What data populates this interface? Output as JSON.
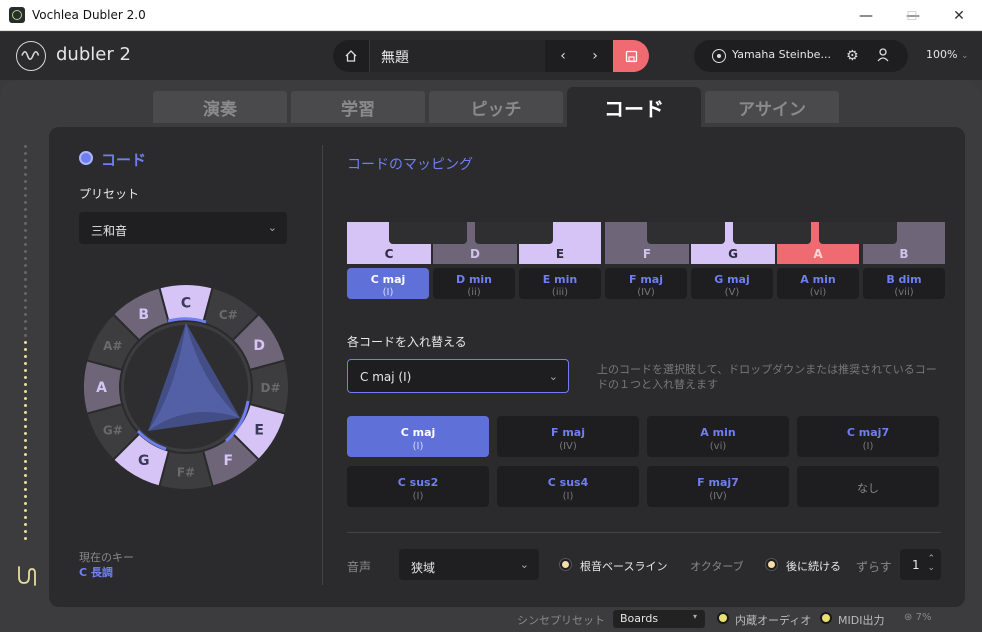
{
  "window": {
    "title": "Vochlea Dubler 2.0",
    "minimize": "—",
    "maximize": "☐",
    "close": "✕"
  },
  "appbar": {
    "logo_text": "dubler 2",
    "project_name": "無題",
    "device_name": "Yamaha Steinbe...",
    "zoom": "100%"
  },
  "tabs": [
    {
      "label": "演奏"
    },
    {
      "label": "学習"
    },
    {
      "label": "ピッチ"
    },
    {
      "label": "コード"
    },
    {
      "label": "アサイン"
    }
  ],
  "left": {
    "toggle_label": "コード",
    "preset_label": "プリセット",
    "preset_value": "三和音",
    "wheel_notes": [
      "C",
      "C#",
      "D",
      "D#",
      "E",
      "F",
      "F#",
      "G",
      "G#",
      "A",
      "A#",
      "B"
    ],
    "current_key_label": "現在のキー",
    "current_key_value": "C 長調"
  },
  "right": {
    "title": "コードのマッピング",
    "white_keys": [
      "C",
      "D",
      "E",
      "F",
      "G",
      "A",
      "B"
    ],
    "chords": [
      {
        "name": "C maj",
        "num": "(I)"
      },
      {
        "name": "D min",
        "num": "(ii)"
      },
      {
        "name": "E min",
        "num": "(iii)"
      },
      {
        "name": "F maj",
        "num": "(IV)"
      },
      {
        "name": "G maj",
        "num": "(V)"
      },
      {
        "name": "A min",
        "num": "(vi)"
      },
      {
        "name": "B dim",
        "num": "(vii)"
      }
    ],
    "replace_label": "各コードを入れ替える",
    "replace_value": "C maj (I)",
    "replace_hint": "上のコードを選択肢して、ドロップダウンまたは推奨されているコードの１つと入れ替えます",
    "alternatives": [
      {
        "name": "C maj",
        "num": "(I)"
      },
      {
        "name": "F maj",
        "num": "(IV)"
      },
      {
        "name": "A min",
        "num": "(vi)"
      },
      {
        "name": "C maj7",
        "num": "(I)"
      },
      {
        "name": "C sus2",
        "num": "(I)"
      },
      {
        "name": "C sus4",
        "num": "(I)"
      },
      {
        "name": "F maj7",
        "num": "(IV)"
      },
      {
        "name": "なし",
        "num": ""
      }
    ],
    "voice_label": "音声",
    "voice_value": "狭域",
    "root_bass_label": "根音ベースライン",
    "octave_label": "オクターブ",
    "follow_label": "後に続ける",
    "shift_label": "ずらす",
    "shift_value": "1"
  },
  "statusbar": {
    "synth_preset_label": "シンセプリセット",
    "synth_preset_value": "Boards",
    "internal_audio_label": "内蔵オーディオ",
    "midi_out_label": "MIDI出力",
    "cpu_value": "7%"
  },
  "colors": {
    "accent": "#6f7ff2",
    "lavender": "#d6c4f6",
    "muted_key": "#6e6678",
    "red": "#f06a72",
    "yellow_dot": "#e8e070"
  }
}
